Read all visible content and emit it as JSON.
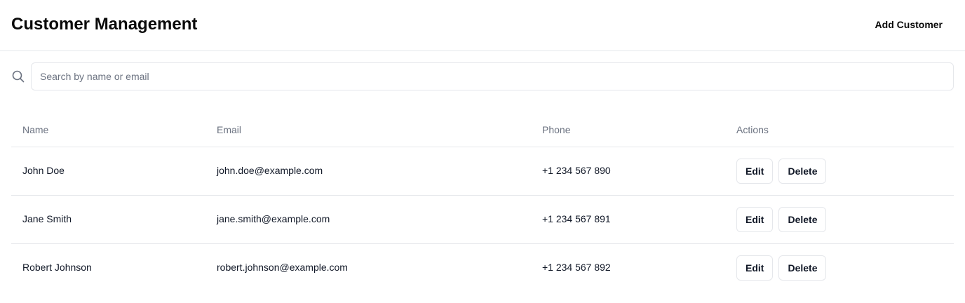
{
  "header": {
    "title": "Customer Management",
    "add_button": "Add Customer"
  },
  "search": {
    "icon": "search-icon",
    "placeholder": "Search by name or email",
    "value": ""
  },
  "table": {
    "columns": [
      "Name",
      "Email",
      "Phone",
      "Actions"
    ],
    "rows": [
      {
        "name": "John Doe",
        "email": "john.doe@example.com",
        "phone": "+1 234 567 890",
        "edit": "Edit",
        "delete": "Delete"
      },
      {
        "name": "Jane Smith",
        "email": "jane.smith@example.com",
        "phone": "+1 234 567 891",
        "edit": "Edit",
        "delete": "Delete"
      },
      {
        "name": "Robert Johnson",
        "email": "robert.johnson@example.com",
        "phone": "+1 234 567 892",
        "edit": "Edit",
        "delete": "Delete"
      }
    ]
  }
}
